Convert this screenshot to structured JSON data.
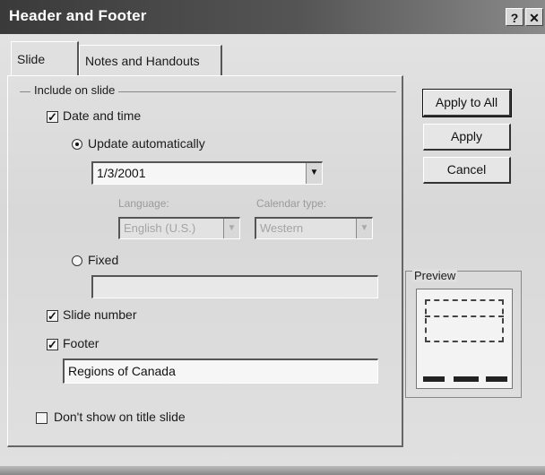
{
  "window": {
    "title": "Header and Footer",
    "help_label": "?",
    "close_label": "✕"
  },
  "tabs": [
    {
      "label": "Slide",
      "selected": true
    },
    {
      "label": "Notes and Handouts",
      "selected": false
    }
  ],
  "include_group": {
    "label": "Include on slide",
    "date_time": {
      "label": "Date and time",
      "checked": true
    },
    "update_auto": {
      "label": "Update automatically",
      "selected": true
    },
    "date_value": "1/3/2001",
    "language_label": "Language:",
    "language_value": "English (U.S.)",
    "calendar_label": "Calendar type:",
    "calendar_value": "Western",
    "fixed": {
      "label": "Fixed",
      "selected": false,
      "value": ""
    },
    "slide_number": {
      "label": "Slide number",
      "checked": true
    },
    "footer": {
      "label": "Footer",
      "checked": true,
      "value": "Regions of Canada"
    }
  },
  "dont_show": {
    "label": "Don't show on title slide",
    "checked": false
  },
  "buttons": {
    "apply_all": "Apply to All",
    "apply": "Apply",
    "cancel": "Cancel"
  },
  "preview": {
    "label": "Preview"
  },
  "check_glyph": "✓",
  "dropdown_glyph": "▼"
}
